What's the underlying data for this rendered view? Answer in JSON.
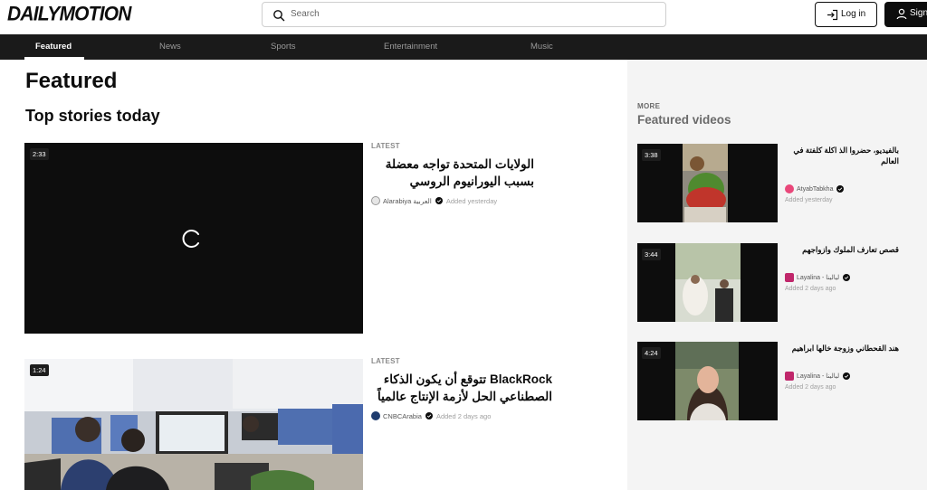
{
  "brand": {
    "logo": "DAILYMOTION"
  },
  "search": {
    "placeholder": "Search"
  },
  "auth": {
    "login": "Log in",
    "signup": "Sign"
  },
  "nav": {
    "tabs": [
      {
        "label": "Featured",
        "active": true
      },
      {
        "label": "News"
      },
      {
        "label": "Sports"
      },
      {
        "label": "Entertainment"
      },
      {
        "label": "Music"
      }
    ]
  },
  "main": {
    "heading": "Featured",
    "subheading": "Top stories today",
    "stories": [
      {
        "duration": "2:33",
        "tag": "LATEST",
        "title": "الولايات المتحدة تواجه معضلة بسبب اليورانيوم الروسي",
        "source": "Alarabiya العربية",
        "added": "Added yesterday",
        "loading": true
      },
      {
        "duration": "1:24",
        "tag": "LATEST",
        "title": "BlackRock تتوقع أن يكون الذكاء الصطناعي الحل لأزمة الإنتاج عالمياً",
        "source": "CNBCArabia",
        "added": "Added 2 days ago"
      }
    ]
  },
  "sidebar": {
    "more": "MORE",
    "title": "Featured videos",
    "videos": [
      {
        "duration": "3:38",
        "title": "بالفيديو، حضروا الذ اكلة كلفتة في العالم",
        "source": "AtyabTabkha",
        "added": "Added yesterday"
      },
      {
        "duration": "3:44",
        "title": "قصص تعارف الملوك وازواجهم",
        "source": "Layalina - ليالينا",
        "added": "Added 2 days ago"
      },
      {
        "duration": "4:24",
        "title": "هند القحطاني وزوجة خالها ابراهيم",
        "source": "Layalina - ليالينا",
        "added": "Added 2 days ago"
      }
    ]
  },
  "colors": {
    "navbar": "#1a1a1a",
    "sidebar": "#f4f4f4",
    "accent_verified": "#0d0d0d"
  }
}
